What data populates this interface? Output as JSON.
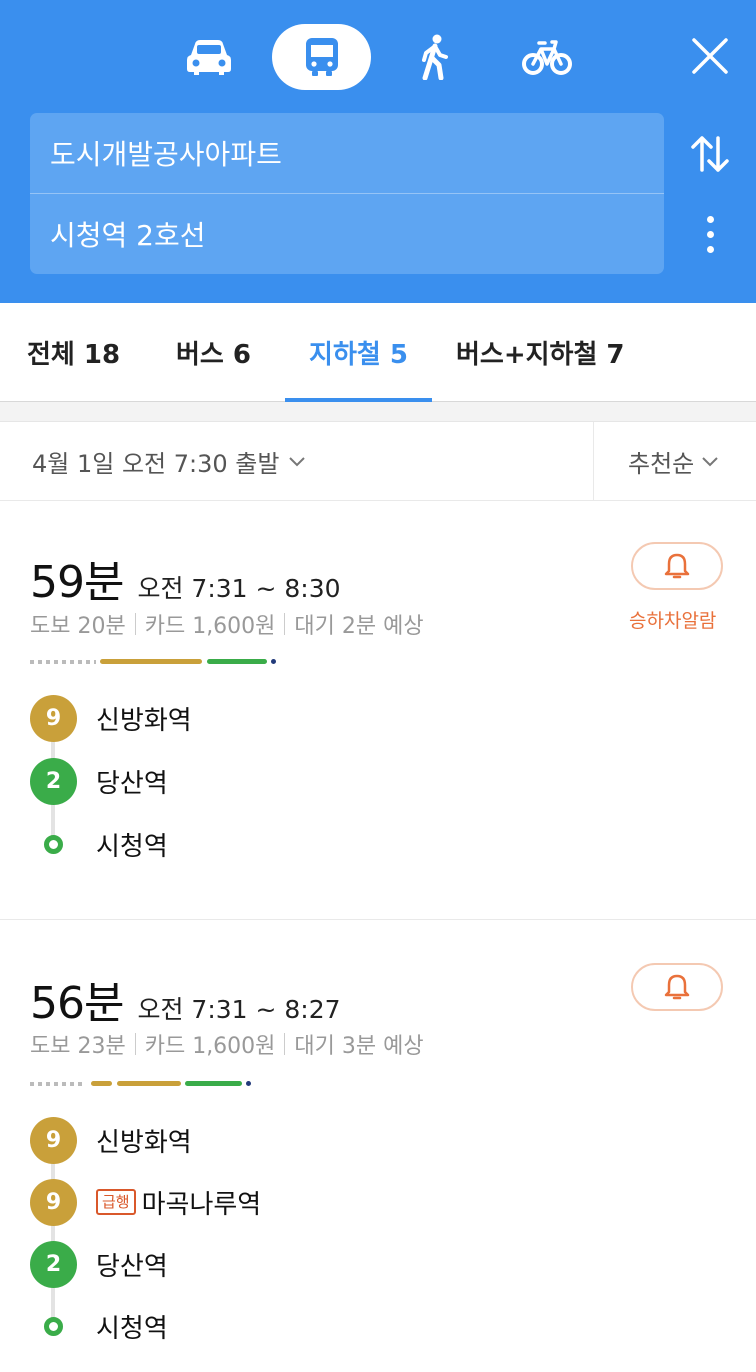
{
  "header": {
    "modes": [
      {
        "name": "car",
        "icon": "car-icon",
        "selected": false
      },
      {
        "name": "transit",
        "icon": "bus-icon",
        "selected": true
      },
      {
        "name": "walk",
        "icon": "walk-icon",
        "selected": false
      },
      {
        "name": "bike",
        "icon": "bike-icon",
        "selected": false
      }
    ],
    "origin": "도시개발공사아파트",
    "destination": "시청역 2호선",
    "close_icon": "close-icon",
    "swap_icon": "swap-icon",
    "more_icon": "more-vertical-icon"
  },
  "tabs": [
    {
      "label": "전체 18",
      "selected": false
    },
    {
      "label": "버스 6",
      "selected": false
    },
    {
      "label": "지하철 5",
      "selected": true
    },
    {
      "label": "버스+지하철 7",
      "selected": false
    }
  ],
  "filter": {
    "departure": "4월 1일 오전 7:30 출발",
    "sort": "추천순"
  },
  "routes": [
    {
      "duration": "59분",
      "time_range": "오전 7:31 ~ 8:30",
      "summary": [
        "도보 20분",
        "카드 1,600원",
        "대기 2분 예상"
      ],
      "alarm_label": "승하차알람",
      "stops": [
        {
          "line": "9",
          "name": "신방화역"
        },
        {
          "line": "2",
          "name": "당산역"
        },
        {
          "line": "",
          "name": "시청역"
        }
      ]
    },
    {
      "duration": "56분",
      "time_range": "오전 7:31 ~ 8:27",
      "summary": [
        "도보 23분",
        "카드 1,600원",
        "대기 3분 예상"
      ],
      "stops": [
        {
          "line": "9",
          "name": "신방화역"
        },
        {
          "line": "9",
          "badge": "급행",
          "name": "마곡나루역"
        },
        {
          "line": "2",
          "name": "당산역"
        },
        {
          "line": "",
          "name": "시청역"
        }
      ]
    }
  ],
  "colors": {
    "header_blue": "#3a8fee",
    "line9": "#c9a03a",
    "line2": "#3aac49",
    "alarm_orange": "#e9713b"
  }
}
